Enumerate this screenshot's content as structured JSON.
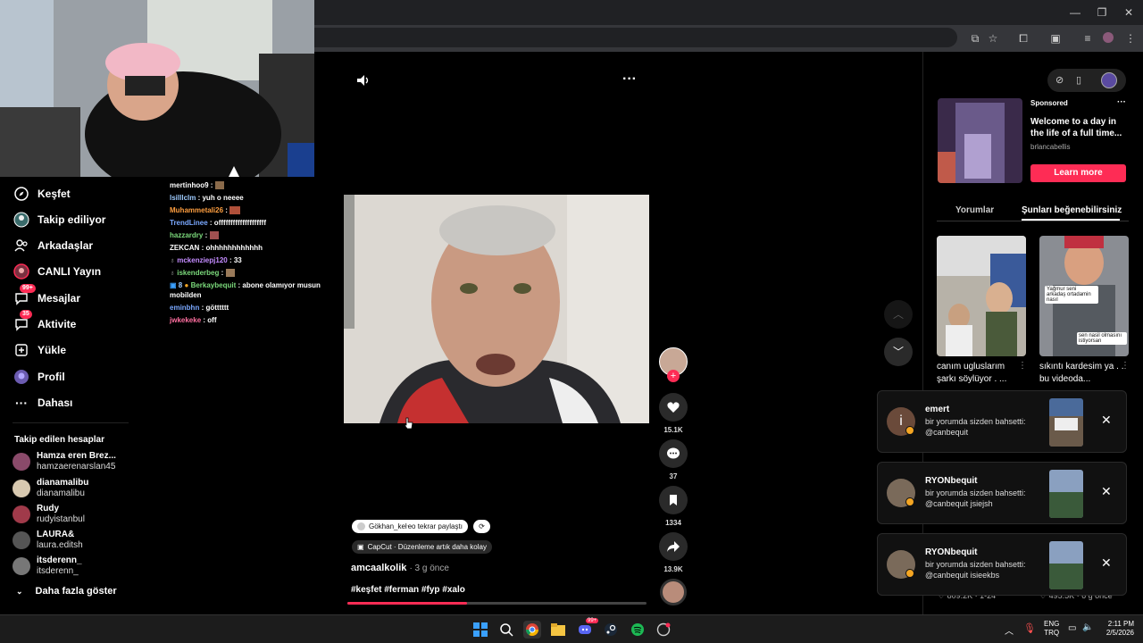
{
  "window": {
    "minimize": "—",
    "restore": "❐",
    "close": "✕"
  },
  "toolbar_icons": [
    "install-icon",
    "star-icon",
    "extensions-icon",
    "reading-icon",
    "media-icon",
    "profile-icon",
    "menu-icon"
  ],
  "sidebar": {
    "items": [
      {
        "label": "Keşfet",
        "icon": "compass-icon"
      },
      {
        "label": "Takip ediliyor",
        "icon": "following-avatar-icon"
      },
      {
        "label": "Arkadaşlar",
        "icon": "friends-icon"
      },
      {
        "label": "CANLI Yayın",
        "icon": "live-icon"
      },
      {
        "label": "Mesajlar",
        "icon": "messages-icon",
        "badge": "99+"
      },
      {
        "label": "Aktivite",
        "icon": "activity-icon",
        "badge": "35"
      },
      {
        "label": "Yükle",
        "icon": "upload-icon"
      },
      {
        "label": "Profil",
        "icon": "profile-icon"
      },
      {
        "label": "Dahası",
        "icon": "more-icon"
      }
    ],
    "following_heading": "Takip edilen hesaplar",
    "following": [
      {
        "name": "Hamza eren Brez...",
        "handle": "hamzaerenarslan45"
      },
      {
        "name": "dianamalibu",
        "handle": "dianamalibu"
      },
      {
        "name": "Rudy",
        "handle": "rudyistanbul"
      },
      {
        "name": "LAURA&",
        "handle": "laura.editsh"
      },
      {
        "name": "itsderenn_",
        "handle": "itsderenn_"
      }
    ],
    "show_more": "Daha fazla göster"
  },
  "chat": [
    {
      "user": "mertinhoo9",
      "msg": ":",
      "color": "#ffffff"
    },
    {
      "user": "lsilllclm",
      "msg": ": yuh o neeee",
      "color": "#9ecbff"
    },
    {
      "user": "Muhammetali26",
      "msg": ":",
      "color": "#ff9f40"
    },
    {
      "user": "TrendLinee",
      "msg": ": offffffffffffffffffff",
      "color": "#7aa8ff"
    },
    {
      "user": "hazzardry",
      "msg": ":",
      "color": "#7bd97b"
    },
    {
      "user": "ZEKCAN",
      "msg": ": ohhhhhhhhhhhh",
      "color": "#ffffff"
    },
    {
      "user": "mckenziepj120",
      "msg": ": 33",
      "color": "#c48cff"
    },
    {
      "user": "iskenderbeg",
      "msg": ":",
      "color": "#7bd97b"
    },
    {
      "user": "Berkaybequit",
      "msg": ": abone olamıyor musun",
      "color": "#7bd97b"
    },
    {
      "user": "",
      "msg": "mobilden",
      "color": "#ffffff"
    },
    {
      "user": "eminbhn",
      "msg": ": götttttt",
      "color": "#7aa8ff"
    },
    {
      "user": "jwkekeke",
      "msg": ": off",
      "color": "#ff6fa0"
    }
  ],
  "chat_badge_8": "8",
  "video": {
    "volume_icon": "speaker-icon",
    "more": "···",
    "repost_pill": "Gökhan_keŀeo tekrar paylaştı",
    "capcut_pill": "CapCut · Düzenleme artık daha kolay",
    "author": "amcaalkolik",
    "time": "· 3 g önce",
    "tags": "#keşfet #ferman #fyp #xalo",
    "progress": 0.4
  },
  "actions": {
    "likes": "15.1K",
    "comments": "37",
    "saves": "1334",
    "shares": "13.9K"
  },
  "right": {
    "sponsored": "Sponsored",
    "ad_title": "Welcome to a day in the life of a full time...",
    "ad_author": "brlancabellis",
    "ad_cta": "Learn more",
    "tab_comments": "Yorumlar",
    "tab_like": "Şunları beğenebilirsiniz",
    "thumb1_title": "canım ugluslarım şarkı söylüyor . ...",
    "thumb2_title": "sıkıntı kardesim ya . . bu videoda...",
    "thumb2_sticker1": "Yağmur seni arkadaş ortadamin nasıl",
    "thumb2_sticker2": "sen nasil olmasını istiyorsan",
    "bottom_left_count": "809.2K · 1-24",
    "bottom_right_count": "495.5K · 6 g önce"
  },
  "notifications": [
    {
      "title": "emert",
      "body": "bir yorumda sizden bahsetti: @canbequit",
      "avatar_letter": "i"
    },
    {
      "title": "RYONbequit",
      "body": "bir yorumda sizden bahsetti: @canbequit jsiejsh"
    },
    {
      "title": "RYONbequit",
      "body": "bir yorumda sizden bahsetti: @canbequit isieekbs"
    }
  ],
  "taskbar": {
    "lang1": "ENG",
    "lang2": "TRQ",
    "time": "2:11 PM",
    "date": "2/5/2026",
    "discord_badge": "99+"
  }
}
